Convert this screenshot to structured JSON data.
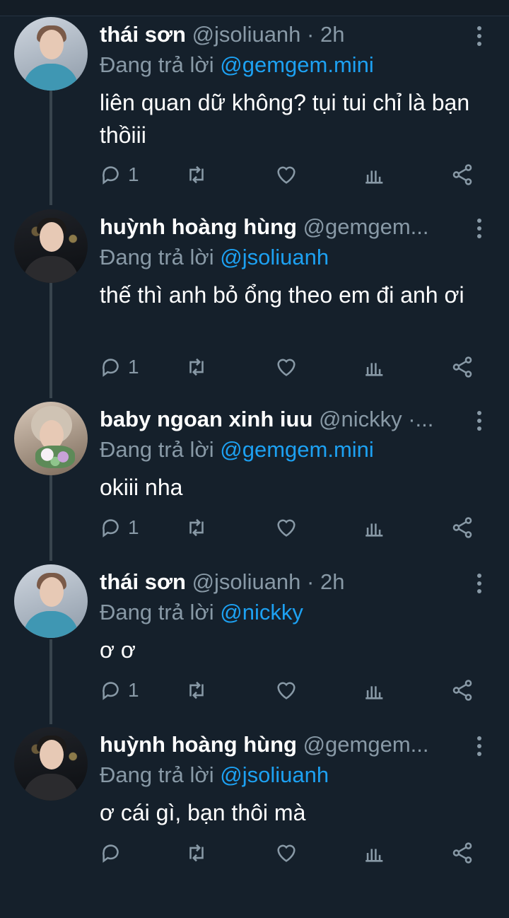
{
  "replying_prefix": "Đang trả lời",
  "colors": {
    "background": "#15202b",
    "accent": "#1da1f2",
    "muted": "#8899a6"
  },
  "tweets": [
    {
      "name": "thái sơn",
      "handle": "@jsoliuanh · 2h",
      "replying_to": "@gemgem.mini",
      "text": "liên quan dữ không? tụi tui chỉ là bạn thồiii",
      "reply_count": "1",
      "avatar": "avatar-thai-son"
    },
    {
      "name": "huỳnh hoàng hùng",
      "handle": "@gemgem...",
      "replying_to": "@jsoliuanh",
      "text": "thế thì anh bỏ ổng theo em đi anh ơi",
      "reply_count": "1",
      "avatar": "avatar-huynh-hoang-hung"
    },
    {
      "name": "baby ngoan xinh iuu",
      "handle": "@nickky ·...",
      "replying_to": "@gemgem.mini",
      "text": "okiii nha",
      "reply_count": "1",
      "avatar": "avatar-baby-ngoan"
    },
    {
      "name": "thái sơn",
      "handle": "@jsoliuanh · 2h",
      "replying_to": "@nickky",
      "text": "ơ ơ",
      "reply_count": "1",
      "avatar": "avatar-thai-son"
    },
    {
      "name": "huỳnh hoàng hùng",
      "handle": "@gemgem...",
      "replying_to": "@jsoliuanh",
      "text": "ơ cái gì, bạn thôi mà",
      "reply_count": "",
      "avatar": "avatar-huynh-hoang-hung"
    }
  ]
}
